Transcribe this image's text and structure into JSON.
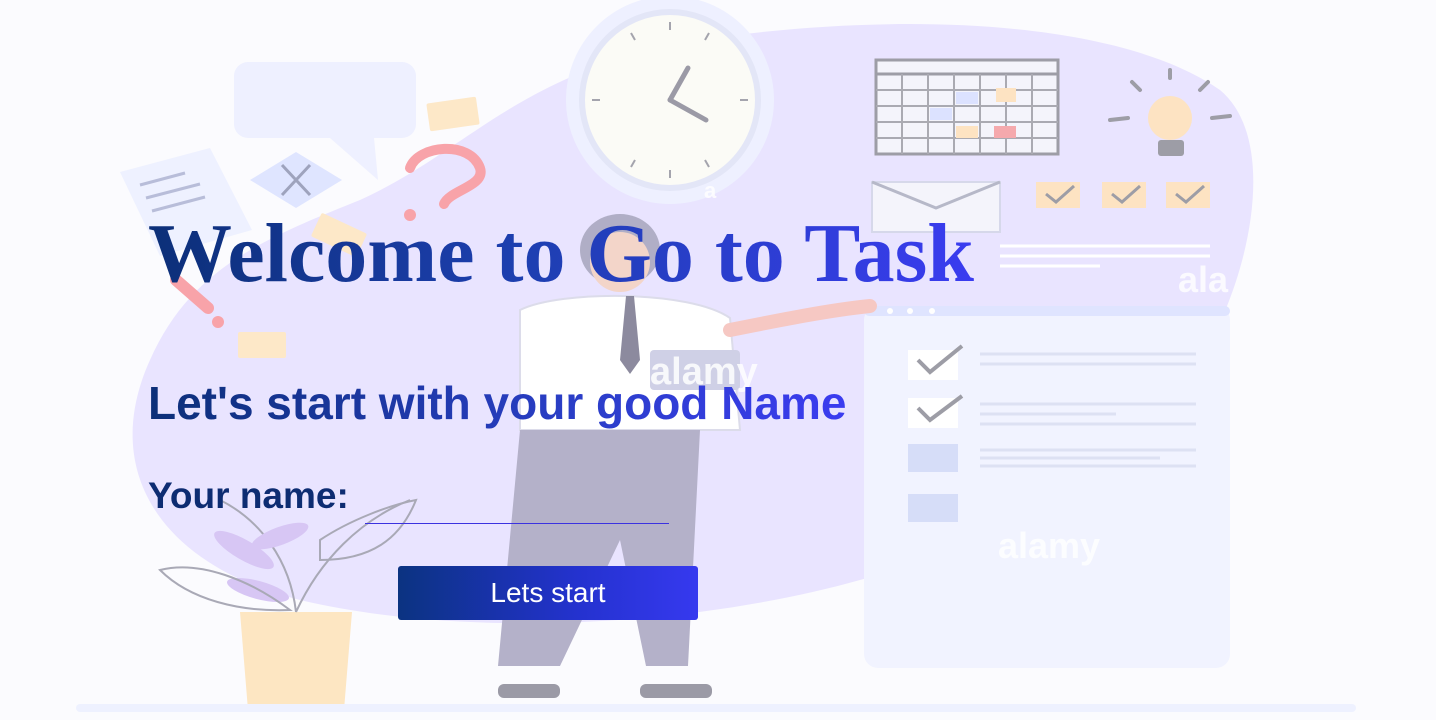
{
  "page": {
    "title": "Welcome to Go to Task",
    "subtitle": "Let's start with your good Name"
  },
  "form": {
    "name_label": "Your name:",
    "name_value": "",
    "start_button_label": "Lets start"
  },
  "background": {
    "watermark_texts": [
      "alamy",
      "alamy",
      "ala",
      "a"
    ],
    "colors": {
      "blob": "#e7e2ff",
      "accent_gradient_start": "#0b3381",
      "accent_gradient_end": "#3639ef"
    }
  }
}
